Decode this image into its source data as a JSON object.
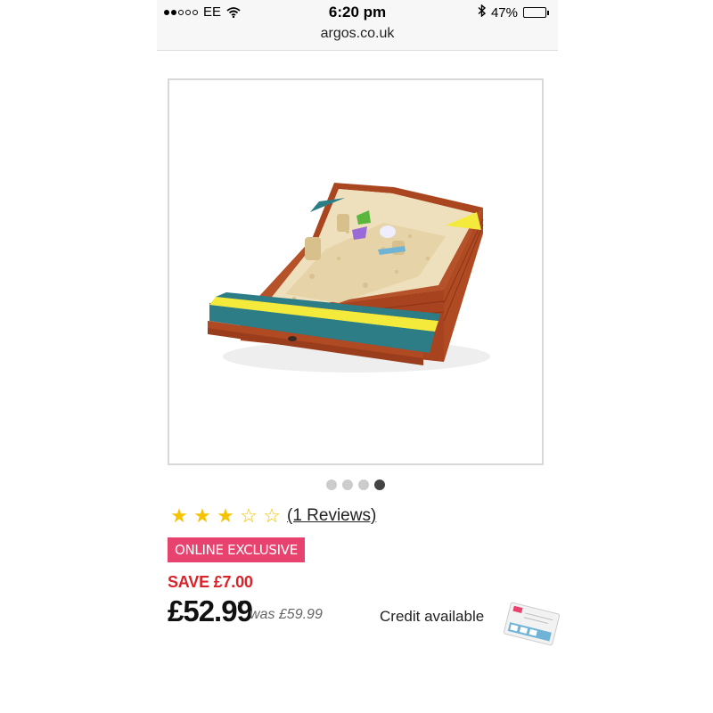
{
  "status_bar": {
    "carrier": "EE",
    "time": "6:20 pm",
    "battery": "47%",
    "battery_level": 0.47,
    "url": "argos.co.uk"
  },
  "product": {
    "image_icon": "sandpit-product-image",
    "carousel": {
      "total": 4,
      "active_index": 3
    },
    "rating": {
      "stars": 3,
      "max": 5,
      "reviews_label": "(1 Reviews)"
    },
    "badge": "ONLINE EXCLUSIVE",
    "save": "SAVE £7.00",
    "price": "£52.99",
    "asterisk": "*",
    "was_price": "was £59.99",
    "credit": "Credit available"
  },
  "colors": {
    "badge": "#e8426e",
    "save": "#d8232a",
    "star": "#f6c300"
  }
}
